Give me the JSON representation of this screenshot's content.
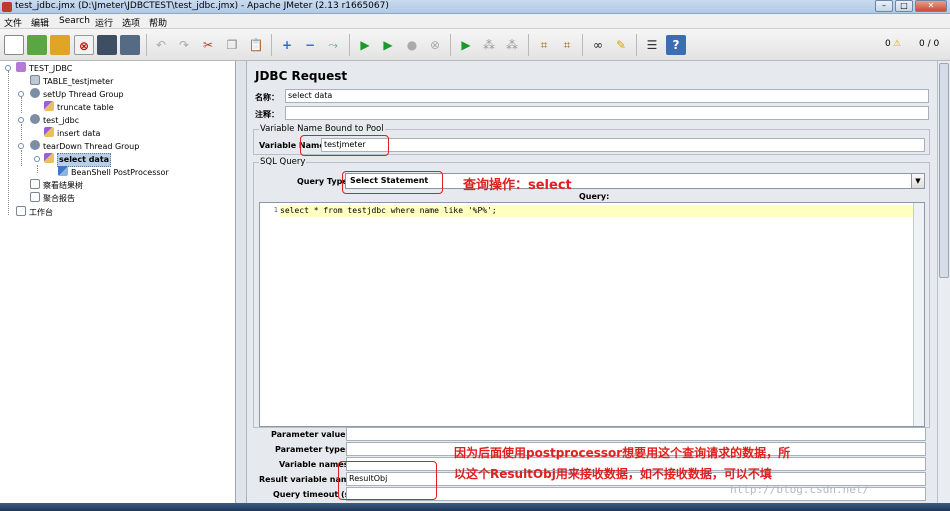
{
  "window": {
    "title": "test_jdbc.jmx (D:\\Jmeter\\JDBCTEST\\test_jdbc.jmx) - Apache JMeter (2.13 r1665067)"
  },
  "menu": [
    "文件",
    "编辑",
    "Search",
    "运行",
    "选项",
    "帮助"
  ],
  "toolbar": {
    "warnings": "0",
    "threads": "0 / 0"
  },
  "tree": [
    {
      "label": "TEST_JDBC",
      "level": 0,
      "icon": "testplan-icon"
    },
    {
      "label": "TABLE_testjmeter",
      "level": 1,
      "icon": "config-icon"
    },
    {
      "label": "setUp Thread Group",
      "level": 1,
      "icon": "thread-group-icon"
    },
    {
      "label": "truncate table",
      "level": 2,
      "icon": "sampler-icon"
    },
    {
      "label": "test_jdbc",
      "level": 1,
      "icon": "thread-group-icon"
    },
    {
      "label": "insert data",
      "level": 2,
      "icon": "sampler-icon"
    },
    {
      "label": "tearDown Thread Group",
      "level": 1,
      "icon": "thread-group-icon"
    },
    {
      "label": "select data",
      "level": 2,
      "icon": "sampler-icon",
      "selected": true
    },
    {
      "label": "BeanShell PostProcessor",
      "level": 3,
      "icon": "postprocessor-icon"
    },
    {
      "label": "察看结果树",
      "level": 1,
      "icon": "listener-icon"
    },
    {
      "label": "聚合报告",
      "level": 1,
      "icon": "listener-icon"
    },
    {
      "label": "工作台",
      "level": 0,
      "icon": "workbench-icon"
    }
  ],
  "panel": {
    "heading": "JDBC Request",
    "name_label": "名称：",
    "name_value": "select data",
    "comment_label": "注释：",
    "comment_value": "",
    "pool_group": "Variable Name Bound to Pool",
    "variable_name_label": "Variable Name:",
    "variable_name_value": "testjmeter",
    "sql_group": "SQL Query",
    "query_type_label": "Query Type:",
    "query_type_value": "Select Statement",
    "query_label": "Query:",
    "query_line_no": "1",
    "query_text": "select * from testjdbc where name like '%P%';",
    "param_values_label": "Parameter values:",
    "param_types_label": "Parameter types:",
    "variable_names_label": "Variable names:",
    "result_var_label": "Result variable name:",
    "result_var_value": "ResultObj",
    "timeout_label": "Query timeout (s):"
  },
  "annotations": {
    "query_type_note": "查询操作：select",
    "result_note_line1": "因为后面使用postprocessor想要用这个查询请求的数据，所",
    "result_note_line2": "以这个ResultObj用来接收数据，如不接收数据，可以不填"
  },
  "watermark": "http://blog.csdn.net/",
  "colors": {
    "annotation": "#e02020",
    "selection": "#b8cfe5",
    "query_highlight": "#ffffc0"
  }
}
